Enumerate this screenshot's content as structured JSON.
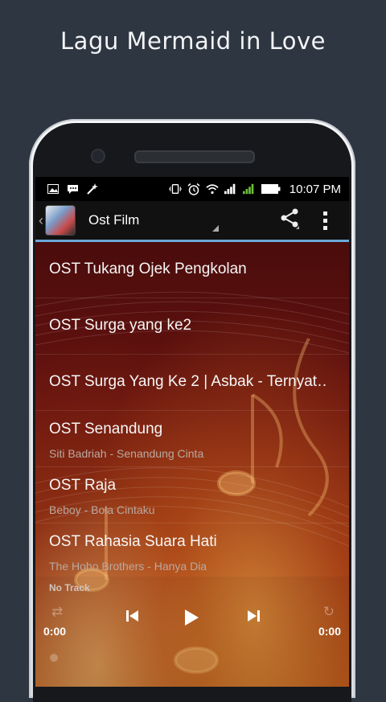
{
  "headline": "Lagu Mermaid in Love",
  "status_bar": {
    "time": "10:07 PM",
    "left_icons": [
      "image-icon",
      "bbm-icon",
      "magic-wand-icon"
    ],
    "right_icons": [
      "vibrate-icon",
      "alarm-icon",
      "wifi-icon",
      "signal-icon",
      "battery-icon"
    ]
  },
  "action_bar": {
    "title": "Ost Film",
    "share_icon": "share-icon",
    "overflow_icon": "overflow-menu-icon"
  },
  "songs": [
    {
      "title": "OST Tukang Ojek Pengkolan",
      "subtitle": ""
    },
    {
      "title": "OST Surga yang ke2",
      "subtitle": ""
    },
    {
      "title": "OST Surga Yang Ke 2 | Asbak - Ternyat…",
      "subtitle": ""
    },
    {
      "title": "OST Senandung",
      "subtitle": "Siti Badriah - Senandung Cinta"
    },
    {
      "title": "OST Raja",
      "subtitle": "Beboy - Bola Cintaku"
    },
    {
      "title": "OST Rahasia Suara Hati",
      "subtitle": "The Hoho Brothers - Hanya Dia"
    }
  ],
  "player": {
    "track_label": "No Track",
    "time_left": "0:00",
    "time_right": "0:00"
  },
  "colors": {
    "background": "#2e3641",
    "action_bar_underline": "#6aa8d8"
  }
}
